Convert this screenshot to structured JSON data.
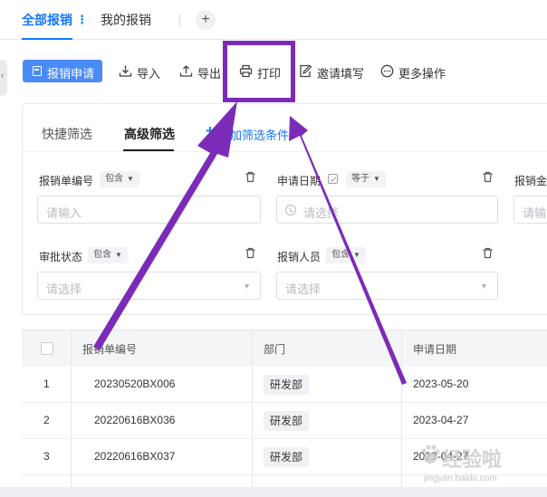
{
  "tabs": {
    "all": "全部报销",
    "more_dots": "⋮",
    "mine": "我的报销",
    "add": "+"
  },
  "toolbar": {
    "primary_label": "报销申请",
    "import_label": "导入",
    "export_label": "导出",
    "print_label": "打印",
    "invite_label": "邀请填写",
    "more_label": "更多操作",
    "collapse_icon": "‹"
  },
  "filter": {
    "tabs": [
      "快捷筛选",
      "高级筛选"
    ],
    "add_label": "添加筛选条件",
    "add_plus": "+",
    "fields": [
      {
        "label": "报销单编号",
        "operator": "包含",
        "placeholder": "请输入"
      },
      {
        "label": "申请日期",
        "operator": "等于",
        "placeholder": "请选择"
      },
      {
        "label": "报销金",
        "placeholder": "请输入"
      },
      {
        "label": "审批状态",
        "operator": "包含",
        "placeholder": "请选择"
      },
      {
        "label": "报销人员",
        "operator": "包含",
        "placeholder": "请选择"
      }
    ],
    "caret": "▼"
  },
  "table": {
    "headers": [
      "报销单编号",
      "部门",
      "申请日期"
    ],
    "rows": [
      {
        "index": "1",
        "code": "20230520BX006",
        "dept": "研发部",
        "date": "2023-05-20"
      },
      {
        "index": "2",
        "code": "20220616BX036",
        "dept": "研发部",
        "date": "2023-04-27"
      },
      {
        "index": "3",
        "code": "20220616BX037",
        "dept": "研发部",
        "date": "2023-04-27"
      }
    ]
  },
  "watermark": {
    "text": "经验啦",
    "url": "jingyan.baidu.com"
  },
  "colors": {
    "accent": "#1677ff",
    "primary_button": "#4a8cf7",
    "annotation": "#7b2bb8"
  }
}
